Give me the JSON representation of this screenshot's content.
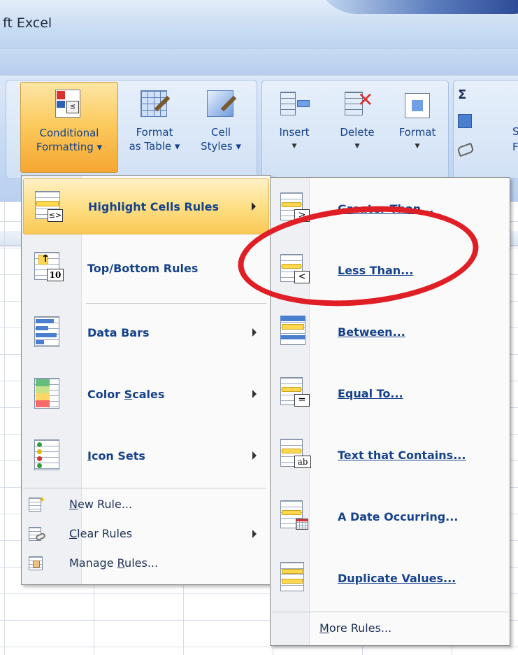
{
  "window": {
    "title_fragment": "ft Excel"
  },
  "ribbon": {
    "styles_group": [
      {
        "id": "conditional_formatting",
        "line1": "Conditional",
        "line2": "Formatting ▾",
        "active": true
      },
      {
        "id": "format_as_table",
        "line1": "Format",
        "line2": "as Table ▾"
      },
      {
        "id": "cell_styles",
        "line1": "Cell",
        "line2": "Styles ▾"
      }
    ],
    "cells_group": [
      {
        "id": "insert",
        "label": "Insert"
      },
      {
        "id": "delete",
        "label": "Delete"
      },
      {
        "id": "format",
        "label": "Format"
      }
    ],
    "editing_partial": {
      "sigma": "Σ",
      "s_fragment": "S",
      "f_fragment": "F"
    }
  },
  "cf_menu": {
    "items": [
      {
        "id": "highlight_cells_rules",
        "label": "Highlight Cells Rules",
        "has_submenu": true,
        "highlighted": true
      },
      {
        "id": "top_bottom_rules",
        "label": "Top/Bottom Rules",
        "has_submenu": false
      },
      {
        "id": "data_bars",
        "label": "Data Bars",
        "has_submenu": true
      },
      {
        "id": "color_scales",
        "label": "Color Scales",
        "has_submenu": true
      },
      {
        "id": "icon_sets",
        "label": "Icon Sets",
        "has_submenu": true
      }
    ],
    "small_items": [
      {
        "id": "new_rule",
        "label": "New Rule..."
      },
      {
        "id": "clear_rules",
        "label": "Clear Rules",
        "has_submenu": true
      },
      {
        "id": "manage_rules",
        "label": "Manage Rules..."
      }
    ]
  },
  "submenu": {
    "items": [
      {
        "id": "greater_than",
        "label": "Greater Than..."
      },
      {
        "id": "less_than",
        "label": "Less Than..."
      },
      {
        "id": "between",
        "label": "Between..."
      },
      {
        "id": "equal_to",
        "label": "Equal To..."
      },
      {
        "id": "text_contains",
        "label": "Text that Contains..."
      },
      {
        "id": "date_occurring",
        "label": "A Date Occurring..."
      },
      {
        "id": "duplicate_values",
        "label": "Duplicate Values..."
      }
    ],
    "more_rules": "More Rules..."
  },
  "annotation": {
    "color": "#e01e25",
    "shape": "ellipse"
  },
  "colors": {
    "ribbon_text": "#15428b",
    "highlight": "#fddf86",
    "menu_bg": "#fafafa"
  }
}
